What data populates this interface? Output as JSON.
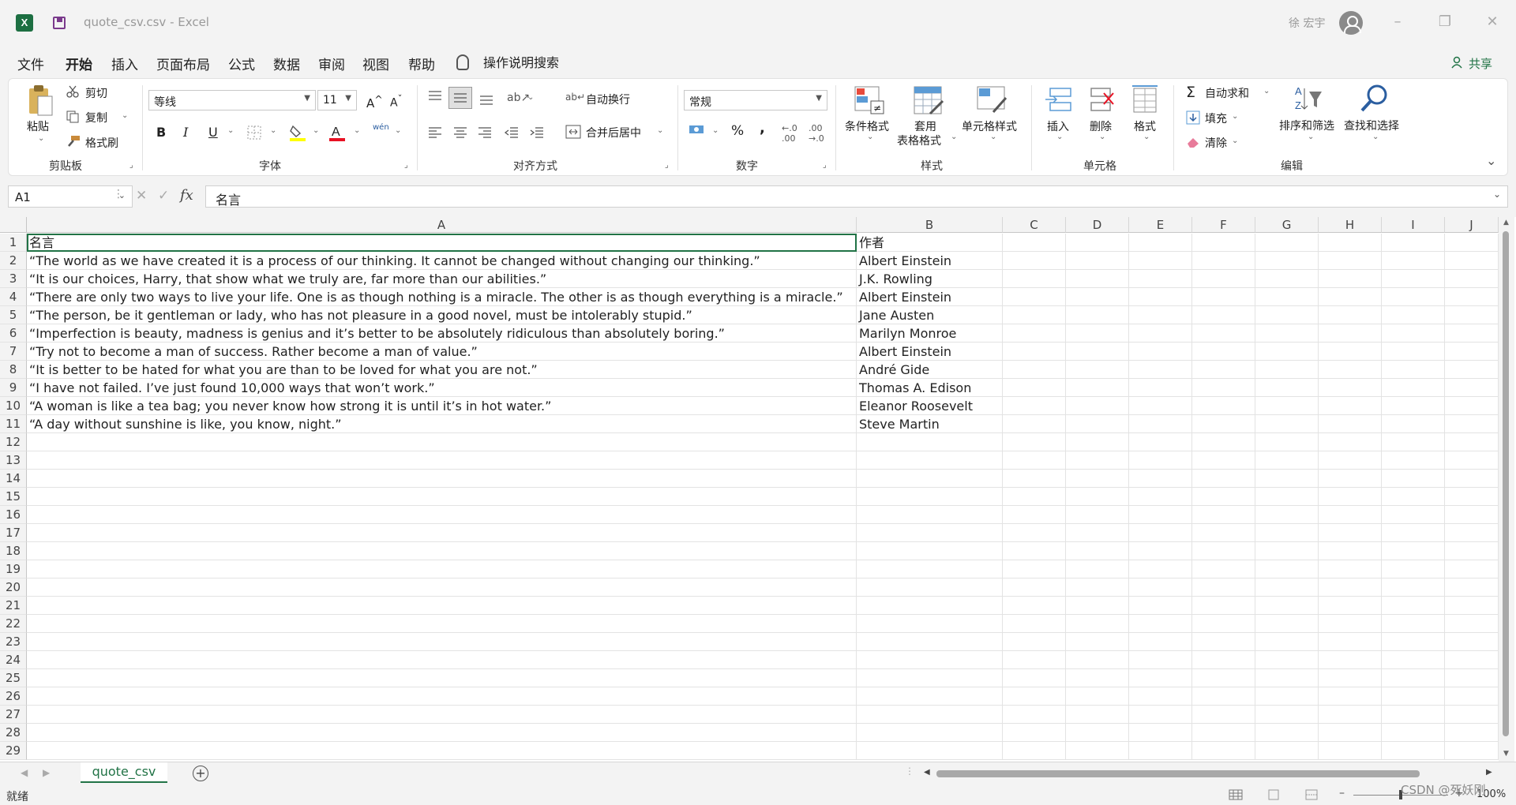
{
  "window": {
    "doc_title": "quote_csv.csv  -  Excel",
    "user": "徐 宏宇",
    "app_icon": "X"
  },
  "menu": [
    "文件",
    "开始",
    "插入",
    "页面布局",
    "公式",
    "数据",
    "审阅",
    "视图",
    "帮助"
  ],
  "tell_me": "操作说明搜索",
  "share": "共享",
  "ribbon": {
    "clipboard": {
      "paste": "粘贴",
      "cut": "剪切",
      "copy": "复制",
      "format_painter": "格式刷",
      "label": "剪贴板"
    },
    "font": {
      "name": "等线",
      "size": "11",
      "label": "字体",
      "bold": "B",
      "italic": "I",
      "underline": "U",
      "phonetic": "wén"
    },
    "alignment": {
      "wrap": "自动换行",
      "merge": "合并后居中",
      "label": "对齐方式"
    },
    "number": {
      "format": "常规",
      "percent": "%",
      "comma": ",",
      "label": "数字"
    },
    "styles": {
      "conditional": "条件格式",
      "table_1": "套用",
      "table_2": "表格格式",
      "cell_styles": "单元格样式",
      "label": "样式"
    },
    "cells": {
      "insert": "插入",
      "delete": "删除",
      "format": "格式",
      "label": "单元格"
    },
    "editing": {
      "autosum": "自动求和",
      "fill": "填充",
      "clear": "清除",
      "sort": "排序和筛选",
      "find": "查找和选择",
      "label": "编辑"
    }
  },
  "formula_bar": {
    "name_box": "A1",
    "fx": "fx",
    "content": "名言"
  },
  "columns": [
    "A",
    "B",
    "C",
    "D",
    "E",
    "F",
    "G",
    "H",
    "I",
    "J"
  ],
  "rows": [
    [
      "名言",
      "作者"
    ],
    [
      "“The world as we have created it is a process of our thinking. It cannot be changed without changing our thinking.”",
      "Albert Einstein"
    ],
    [
      "“It is our choices, Harry, that show what we truly are, far more than our abilities.”",
      "J.K. Rowling"
    ],
    [
      "“There are only two ways to live your life. One is as though nothing is a miracle. The other is as though everything is a miracle.”",
      "Albert Einstein"
    ],
    [
      "“The person, be it gentleman or lady, who has not pleasure in a good novel, must be intolerably stupid.”",
      "Jane Austen"
    ],
    [
      "“Imperfection is beauty, madness is genius and it’s better to be absolutely ridiculous than absolutely boring.”",
      "Marilyn Monroe"
    ],
    [
      "“Try not to become a man of success. Rather become a man of value.”",
      "Albert Einstein"
    ],
    [
      "“It is better to be hated for what you are than to be loved for what you are not.”",
      "André Gide"
    ],
    [
      "“I have not failed. I’ve just found 10,000 ways that won’t work.”",
      "Thomas A. Edison"
    ],
    [
      "“A woman is like a tea bag; you never know how strong it is until it’s in hot water.”",
      "Eleanor Roosevelt"
    ],
    [
      "“A day without sunshine is like, you know, night.”",
      "Steve Martin"
    ]
  ],
  "row_count": 29,
  "sheet_tab": "quote_csv",
  "status": "就绪",
  "zoom": "100%",
  "watermark": "CSDN @死妖刚",
  "colors": {
    "accent": "#217346",
    "excel_green": "#1d6f42"
  }
}
